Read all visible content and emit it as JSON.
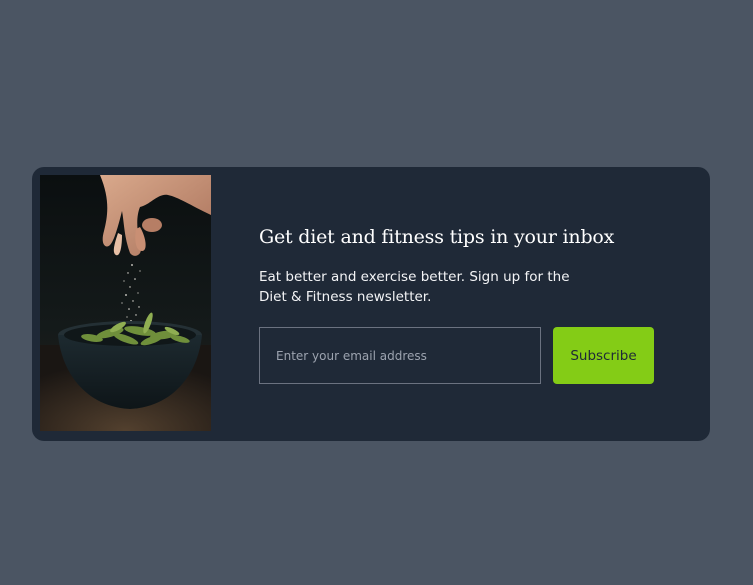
{
  "newsletter": {
    "title": "Get diet and fitness tips in your inbox",
    "description": "Eat better and exercise better. Sign up for the Diet & Fitness newsletter.",
    "email_placeholder": "Enter your email address",
    "subscribe_label": "Subscribe",
    "image_alt": "Hand sprinkling salt over a bowl of edamame"
  },
  "colors": {
    "page_background": "#4b5563",
    "card_background": "#1f2937",
    "button_background": "#84cc16",
    "button_text": "#1f2937",
    "input_border": "#6b7280"
  }
}
